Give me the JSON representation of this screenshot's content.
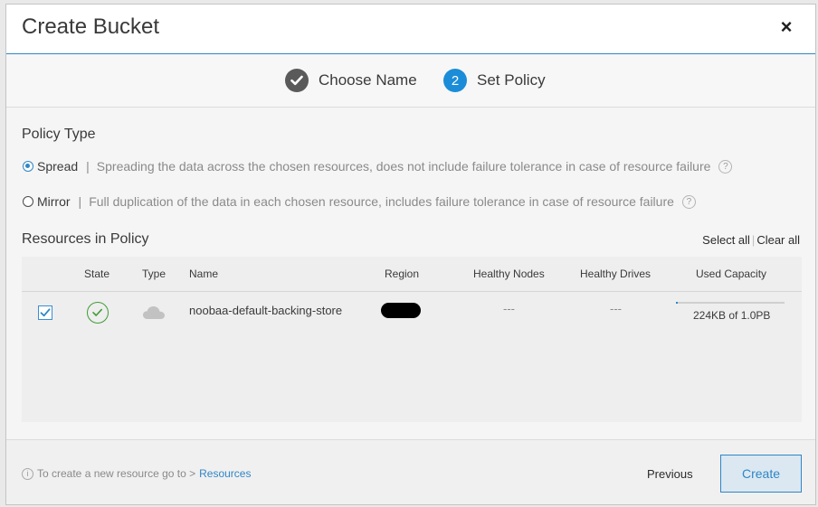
{
  "dialog": {
    "title": "Create Bucket",
    "close_label": "×"
  },
  "wizard": {
    "steps": [
      {
        "label": "Choose Name",
        "state": "completed"
      },
      {
        "label": "Set Policy",
        "number": "2",
        "state": "active"
      }
    ]
  },
  "policy": {
    "title": "Policy Type",
    "options": [
      {
        "label": "Spread",
        "separator": "|",
        "selected": true,
        "description": "Spreading the data across the chosen resources, does not include failure tolerance in case of resource failure"
      },
      {
        "label": "Mirror",
        "separator": "|",
        "selected": false,
        "description": "Full duplication of the data in each chosen resource, includes failure tolerance in case of resource failure"
      }
    ],
    "help_glyph": "?"
  },
  "resources": {
    "title": "Resources in Policy",
    "select_all": "Select all",
    "divider": "|",
    "clear_all": "Clear all",
    "columns": [
      "State",
      "Type",
      "Name",
      "Region",
      "Healthy Nodes",
      "Healthy Drives",
      "Used Capacity"
    ],
    "rows": [
      {
        "checked": true,
        "state_icon": "check-circle-icon",
        "type_icon": "cloud-icon",
        "name": "noobaa-default-backing-store",
        "region": "[redacted]",
        "healthy_nodes": "---",
        "healthy_drives": "---",
        "used_capacity": "224KB of 1.0PB",
        "used_fraction": 0.0
      }
    ]
  },
  "footer": {
    "info_glyph": "i",
    "info_text": "To create a new resource go to >",
    "info_link": "Resources",
    "previous_label": "Previous",
    "create_label": "Create"
  },
  "colors": {
    "accent": "#2f86c6",
    "success": "#3f9c35",
    "step_done": "#5a5a5a",
    "step_active": "#1b8cd8"
  }
}
